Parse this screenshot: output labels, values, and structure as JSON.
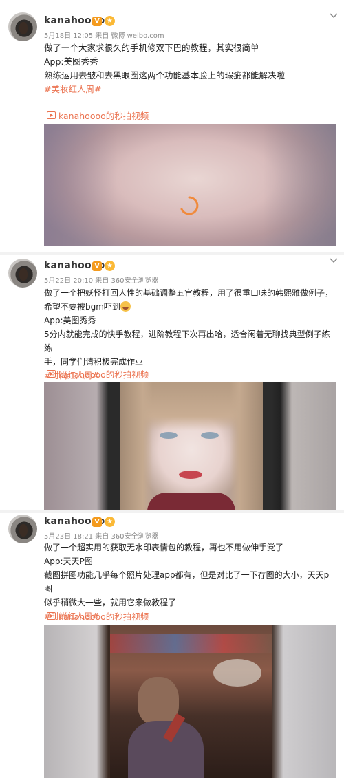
{
  "posts": [
    {
      "username": "kanahoooo",
      "v_badge": "V",
      "meta": "5月18日 12:05 来自 微博 weibo.com",
      "lines": [
        "做了一个大家求很久的手机修双下巴的教程，其实很简单",
        "App:美图秀秀",
        "熟练运用去皱和去黑眼圈这两个功能基本脸上的瑕疵都能解决啦"
      ],
      "topic": "#美妆红人周#",
      "video_link": "kanahoooo的秒拍视频"
    },
    {
      "username": "kanahoooo",
      "v_badge": "V",
      "meta": "5月22日 20:10 来自 360安全浏览器",
      "lines": [
        "做了一个把妖怪打回人性的基础调整五官教程，用了很重口味的韩熙雅做例子，",
        "希望不要被bgm吓到",
        "App:美图秀秀",
        "5分内就能完成的快手教程，进阶教程下次再出哈，适合闲着无聊找典型例子练练",
        "手，同学们请积极完成作业"
      ],
      "topic": "#时尚红人周#",
      "video_link": "kanahoooo的秒拍视频"
    },
    {
      "username": "kanahoooo",
      "v_badge": "V",
      "meta": "5月23日 18:21 来自 360安全浏览器",
      "lines": [
        "做了一个超实用的获取无水印表情包的教程，再也不用做伸手党了",
        "App:天天P图",
        "截图拼图功能几乎每个照片处理app都有，但是对比了一下存图的大小，天天p图",
        "似乎稍微大一些，就用它来做教程了"
      ],
      "topic": "#时尚红人周#",
      "video_link": "kanahoooo的秒拍视频"
    }
  ],
  "colors": {
    "topic": "#eb7350",
    "vip_badge": "#f49b1e",
    "meta": "#8a8a8a"
  },
  "icons": [
    "chevron-down-icon",
    "play-video-icon",
    "laugh-cry-emoji-icon",
    "loading-spinner-icon"
  ]
}
